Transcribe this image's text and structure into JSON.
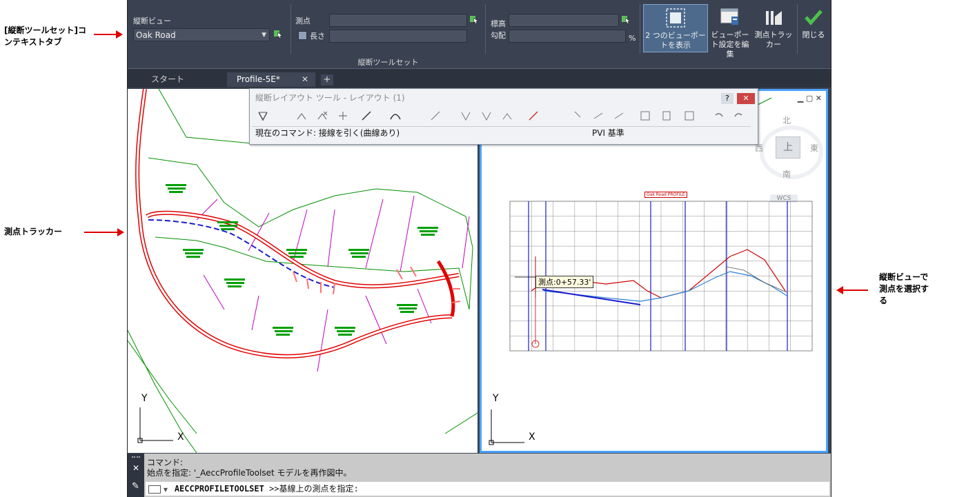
{
  "callouts": {
    "contextual_tab": "[縦断ツールセット]コンテキストタブ",
    "station_tracker": "測点トラッカー",
    "pick_station": "縦断ビューで測点を選択する"
  },
  "ribbon": {
    "profile_view_label": "縦断ビュー",
    "profile_view_value": "Oak Road",
    "station_label": "測点",
    "length_label": "長さ",
    "elevation_label": "標高",
    "grade_label": "勾配",
    "grade_unit": "%",
    "btn_two_viewports": "2 つのビューポートを表示",
    "btn_edit_viewport": "ビューポート設定を編集",
    "btn_station_tracker": "測点トラッカー",
    "btn_close": "閉じる",
    "panel_title": "縦断ツールセット"
  },
  "tabs": [
    {
      "label": "スタート"
    },
    {
      "label": "Profile-5E*"
    }
  ],
  "float_toolbar": {
    "title": "縦断レイアウト ツール - レイアウト (1)",
    "status_left": "現在のコマンド: 接線を引く(曲線あり)",
    "status_right": "PVI 基準"
  },
  "viewcube": {
    "north": "北",
    "south": "南",
    "east": "東",
    "west": "西",
    "top": "上",
    "wcs": "WCS"
  },
  "plot": {
    "title": "Oak Road PROFILE",
    "tooltip": "測点:0+57.33'"
  },
  "ucs": {
    "x": "X",
    "y": "Y"
  },
  "command": {
    "line1": "コマンド:",
    "line2": "始点を指定: '_AeccProfileToolset モデルを再作図中。",
    "prompt_cmd": "AECCPROFILETOOLSET",
    "prompt_rest": " >>基線上の測点を指定:"
  },
  "colors": {
    "accent": "#4aa3ff",
    "alignment": "#e00000",
    "parcel": "#00a000",
    "lot_line": "#c000c0"
  }
}
